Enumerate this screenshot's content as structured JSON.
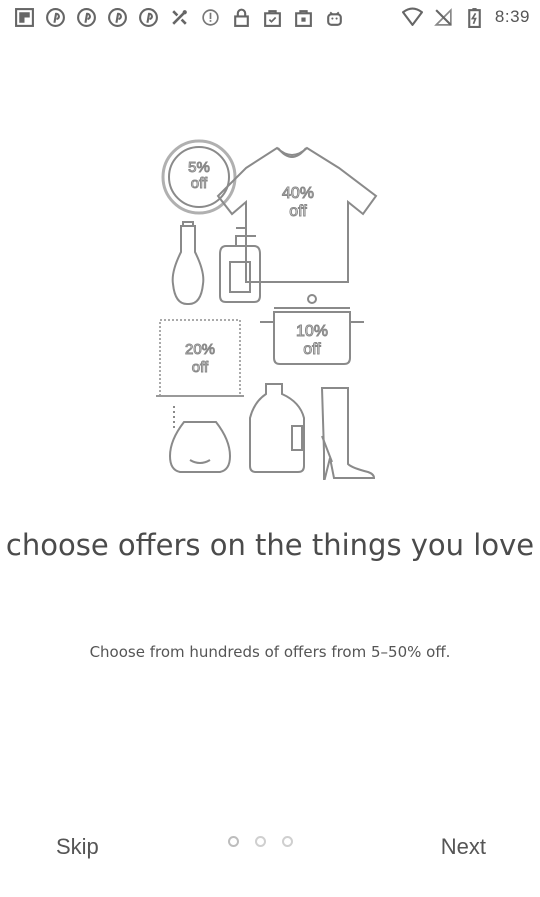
{
  "status_bar": {
    "time": "8:39",
    "left_icons": [
      "flipboard-icon",
      "pinterest-icon",
      "pinterest-icon",
      "pinterest-icon",
      "pinterest-icon",
      "tools-icon",
      "alert-icon",
      "lock-icon",
      "shopping-bag-icon",
      "shopping-bag-icon",
      "android-icon"
    ],
    "right_icons": [
      "wifi-icon",
      "no-signal-icon",
      "battery-icon"
    ]
  },
  "onboarding": {
    "illustration_badges": [
      "5%\noff",
      "40%\noff",
      "20%\noff",
      "10%\noff"
    ],
    "headline": "choose offers on the things you love",
    "description": "Choose from hundreds of offers from 5–50% off."
  },
  "navigation": {
    "skip_label": "Skip",
    "next_label": "Next",
    "page_count": 3,
    "current_page": 1
  }
}
